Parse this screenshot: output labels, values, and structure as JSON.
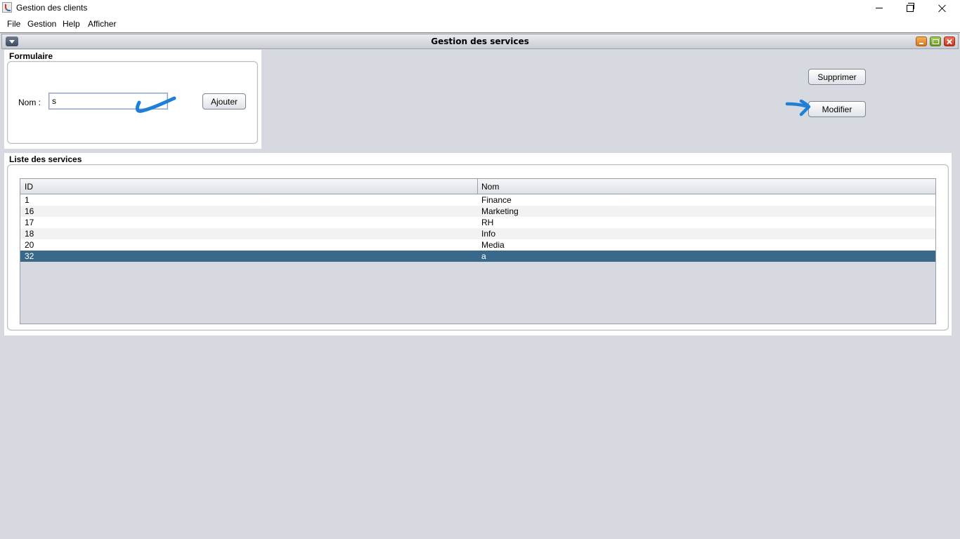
{
  "window": {
    "title": "Gestion des clients",
    "controls": [
      "minimize-icon",
      "restore-icon",
      "close-icon"
    ]
  },
  "menubar": {
    "items": [
      {
        "label": "File",
        "mnemonic": "F"
      },
      {
        "label": "Gestion",
        "mnemonic": "G"
      },
      {
        "label": "Help",
        "mnemonic": "H"
      },
      {
        "label": "Afficher",
        "mnemonic": ""
      }
    ]
  },
  "internal_frame": {
    "title": "Gestion des services"
  },
  "form": {
    "section_title": "Formulaire",
    "nom_label": "Nom :",
    "nom_value": "s",
    "ajouter_label": "Ajouter"
  },
  "actions": {
    "supprimer_label": "Supprimer",
    "modifier_label": "Modifier"
  },
  "list": {
    "section_title": "Liste des services",
    "columns": [
      "ID",
      "Nom"
    ],
    "rows": [
      {
        "id": "1",
        "nom": "Finance"
      },
      {
        "id": "16",
        "nom": "Marketing"
      },
      {
        "id": "17",
        "nom": "RH"
      },
      {
        "id": "18",
        "nom": "Info"
      },
      {
        "id": "20",
        "nom": "Media"
      },
      {
        "id": "32",
        "nom": "a"
      }
    ],
    "selected_row": 5
  },
  "colors": {
    "desktop": "#d6d9df",
    "selection": "#39698a",
    "annotation": "#1f7fd6"
  }
}
